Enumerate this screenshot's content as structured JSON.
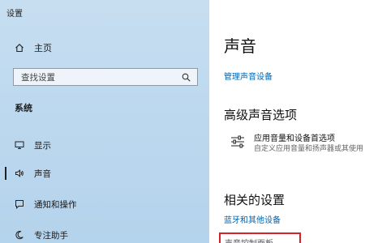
{
  "window": {
    "title": "设置"
  },
  "sidebar": {
    "home_label": "主页",
    "search_placeholder": "查找设置",
    "section_label": "系统",
    "items": [
      {
        "label": "显示",
        "icon": "monitor-icon"
      },
      {
        "label": "声音",
        "icon": "speaker-icon",
        "active": true
      },
      {
        "label": "通知和操作",
        "icon": "notification-icon"
      },
      {
        "label": "专注助手",
        "icon": "moon-icon"
      }
    ]
  },
  "main": {
    "title": "声音",
    "manage_link": "管理声音设备",
    "advanced_heading": "高级声音选项",
    "app_volume": {
      "title": "应用音量和设备首选项",
      "subtitle": "自定义应用音量和扬声器或其使用"
    },
    "related_heading": "相关的设置",
    "bluetooth_link": "蓝牙和其他设备",
    "control_panel_link": "声音控制面板"
  },
  "colors": {
    "link": "#0063b1",
    "highlight": "#d6222a",
    "sidebar": "#bcd8ef"
  }
}
